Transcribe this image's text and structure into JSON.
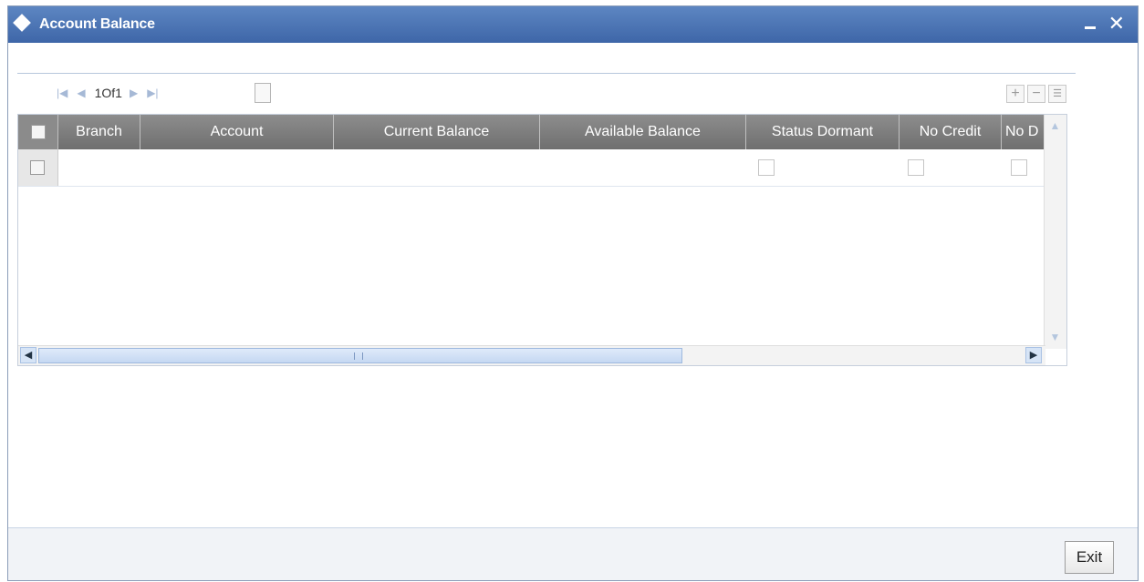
{
  "window": {
    "title": "Account Balance",
    "minimize_label": "_",
    "close_label": "✕"
  },
  "pager": {
    "first": "|◀",
    "prev": "◀",
    "page_text": "1Of1",
    "next": "▶",
    "last": "▶|"
  },
  "toolbar": {
    "add_label": "+",
    "delete_label": "−",
    "columns_label": "☰"
  },
  "table": {
    "columns": [
      "Branch",
      "Account",
      "Current Balance",
      "Available Balance",
      "Status Dormant",
      "No Credit",
      "No D"
    ],
    "rows": [
      {
        "branch": "",
        "account": "",
        "current_balance": "",
        "available_balance": "",
        "status_dormant": false,
        "no_credit": false,
        "no_debit": false
      }
    ]
  },
  "footer": {
    "exit_label": "Exit"
  }
}
